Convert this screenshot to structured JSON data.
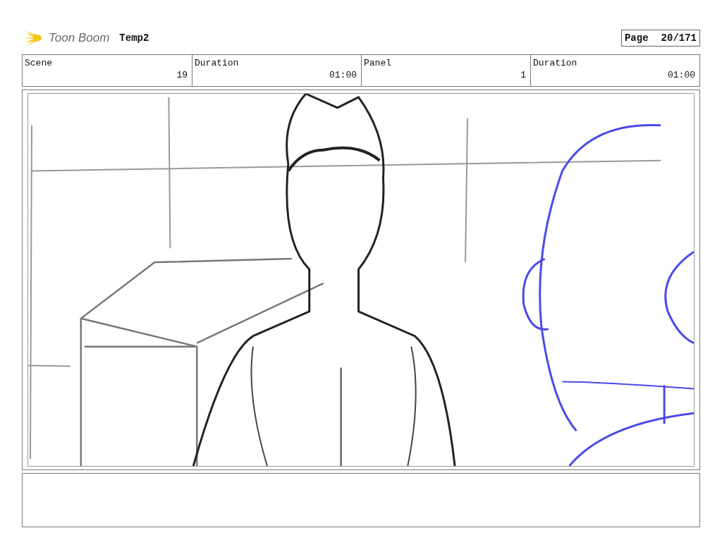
{
  "header": {
    "logo_text": "Toon Boom",
    "project": "Temp2",
    "page_label": "Page",
    "page_number": "20/171"
  },
  "table": {
    "columns": [
      "Scene",
      "Duration",
      "Panel",
      "Duration"
    ],
    "rows": [
      [
        "19",
        "01:00",
        "1",
        "01:00"
      ]
    ]
  }
}
